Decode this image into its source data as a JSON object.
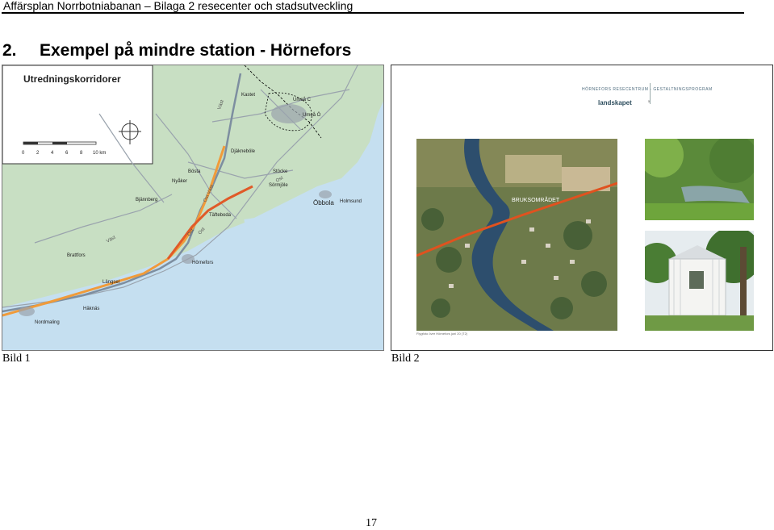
{
  "header": {
    "running_title": "Affärsplan Norrbotniabanan – Bilaga 2 resecenter och stadsutveckling"
  },
  "section": {
    "number": "2.",
    "title": "Exempel på mindre station - Hörnefors"
  },
  "map": {
    "legend_title": "Utredningskorridorer",
    "scale_ticks": [
      "0",
      "2",
      "4",
      "6",
      "8",
      "10 km"
    ],
    "place_names": [
      "Umeå C",
      "Umeå Ö",
      "Kastet",
      "Täfteboda",
      "Öbbola",
      "Holmsund",
      "Djäkneböle",
      "Stöcke",
      "Bösta",
      "Nyåker",
      "Bjännberg",
      "Brattfors",
      "Hörnefors",
      "Längsel",
      "Häknäs",
      "Nordmaling",
      "Sörmjöle"
    ],
    "route_labels": [
      "Väst",
      "Ost",
      "Ost Väst",
      "Ost",
      "Väst",
      "Ost"
    ],
    "colors": {
      "water": "#c5dff0",
      "land": "#c8dfc3",
      "route_orange": "#f09b3a",
      "route_red": "#e05a28",
      "road": "#9aa3ad"
    }
  },
  "photos": {
    "brand_line": "HÖRNEFORS  RESECENTRUM  -  GESTALTNINGSPROGRAM",
    "brand_sub": "landskapet",
    "page_small": "5",
    "aerial_label": "BRUKSOMRÅDET",
    "photo_caption": "Flygfoto över Hörnefors juni 20 (T2)"
  },
  "captions": {
    "left": "Bild 1",
    "right": "Bild 2"
  },
  "footer": {
    "page_number": "17"
  }
}
